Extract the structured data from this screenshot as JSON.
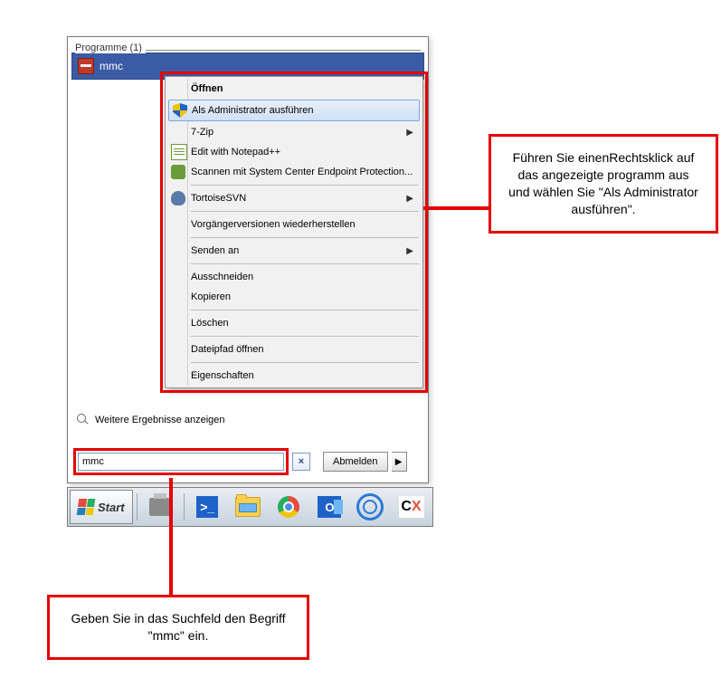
{
  "results_header": "Programme (1)",
  "result_item": "mmc",
  "more_results": "Weitere Ergebnisse anzeigen",
  "search_value": "mmc",
  "logoff_label": "Abmelden",
  "start_label": "Start",
  "context_menu": {
    "open": "Öffnen",
    "run_admin": "Als Administrator ausführen",
    "sevenzip": "7-Zip",
    "edit_npp": "Edit with Notepad++",
    "scan": "Scannen mit System Center Endpoint Protection...",
    "tortoise": "TortoiseSVN",
    "prev_versions": "Vorgängerversionen wiederherstellen",
    "send_to": "Senden an",
    "cut": "Ausschneiden",
    "copy": "Kopieren",
    "delete": "Löschen",
    "open_path": "Dateipfad öffnen",
    "properties": "Eigenschaften"
  },
  "callout_right": "Führen Sie einenRechtsklick auf das angezeigte programm aus und wählen Sie \"Als Administrator ausführen\".",
  "callout_bottom": "Geben Sie in das Suchfeld den Begriff \"mmc\" ein."
}
